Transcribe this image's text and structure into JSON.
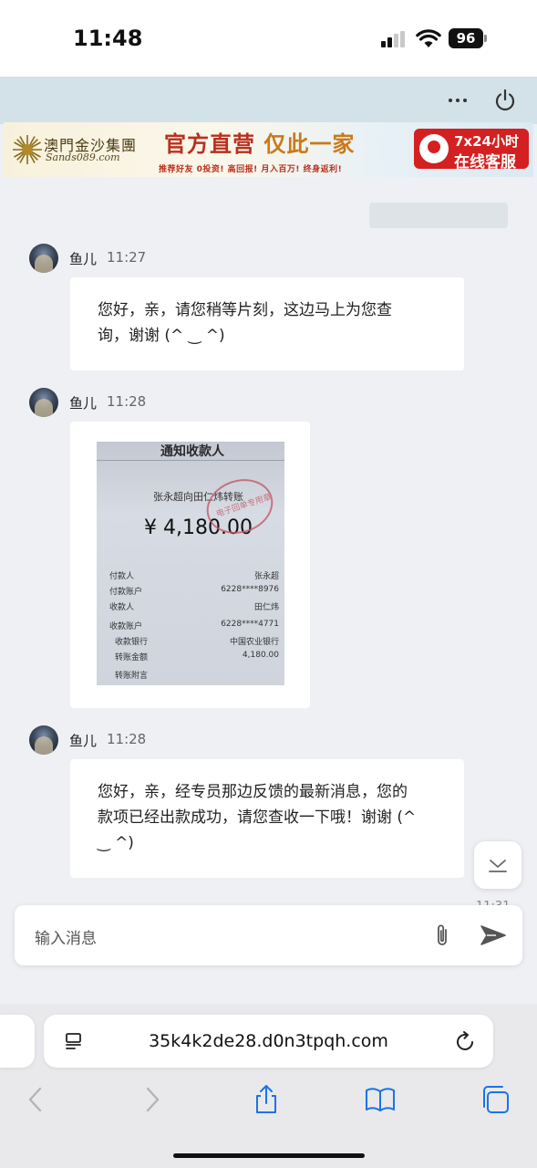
{
  "status": {
    "time": "11:48",
    "battery": "96"
  },
  "banner": {
    "logo_text": "澳門金沙集團",
    "logo_sub": "Sands089.com",
    "slogan_part1": "官方直营",
    "slogan_part2": "仅此一家",
    "subline": "推荐好友 0投资! 高回报! 月入百万! 终身返利!",
    "service_line1": "7x24小时",
    "service_line2": "在线客服"
  },
  "messages": [
    {
      "sender": "鱼儿",
      "time": "11:27",
      "lines": [
        "您好，亲，请您稍等片刻，这边马上为您查",
        "询，谢谢 (^ ‿ ^)"
      ]
    },
    {
      "sender": "鱼儿",
      "time": "11:28",
      "receipt": {
        "title": "通知收款人",
        "description": "张永超向田仁炜转账",
        "amount": "¥ 4,180.00",
        "stamp": "电子回单专用章",
        "rows": [
          {
            "label": "付款人",
            "value": "张永超"
          },
          {
            "label": "付款账户",
            "value": "6228****8976"
          },
          {
            "label": "收款人",
            "value": "田仁炜"
          },
          {
            "label": "收款账户",
            "value": "6228****4771"
          },
          {
            "label": "收款银行",
            "value": "中国农业银行"
          },
          {
            "label": "转账金额",
            "value": "4,180.00"
          },
          {
            "label": "转账附言",
            "value": ""
          }
        ]
      }
    },
    {
      "sender": "鱼儿",
      "time": "11:28",
      "lines": [
        "您好，亲，经专员那边反馈的最新消息，您的",
        "款项已经出款成功，请您查收一下哦！谢谢 (^",
        "‿ ^)"
      ]
    }
  ],
  "peek_time": "11:31",
  "input": {
    "placeholder": "输入消息"
  },
  "browser": {
    "url": "35k4k2de28.d0n3tpqh.com"
  },
  "icons": [
    "more-icon",
    "power-icon",
    "scroll-down-icon",
    "paperclip-icon",
    "send-icon",
    "page-menu-icon",
    "reload-icon",
    "back-icon",
    "forward-icon",
    "share-icon",
    "bookmarks-icon",
    "tabs-icon"
  ]
}
